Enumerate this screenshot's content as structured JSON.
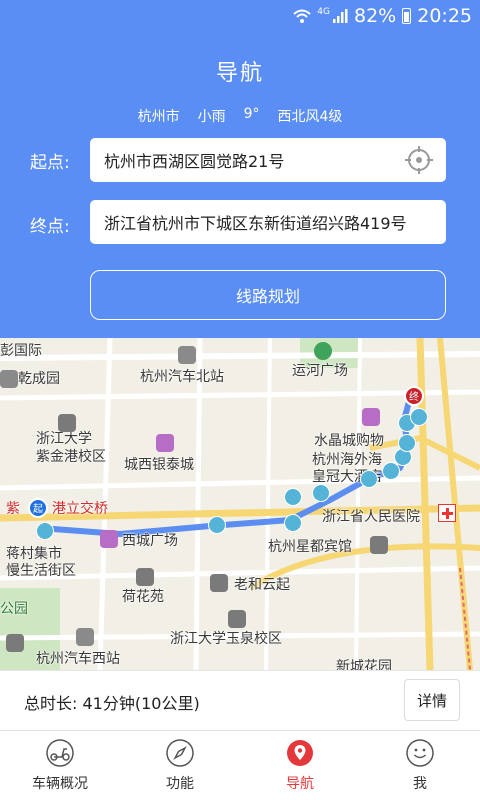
{
  "status_bar": {
    "network": "4G",
    "battery": "82%",
    "time": "20:25"
  },
  "header": {
    "title": "导航",
    "weather": {
      "city": "杭州市",
      "condition": "小雨",
      "temperature": "9°",
      "wind": "西北风4级"
    }
  },
  "form": {
    "start_label": "起点:",
    "start_value": "杭州市西湖区圆觉路21号",
    "end_label": "终点:",
    "end_value": "浙江省杭州市下城区东新街道绍兴路419号",
    "plan_button": "线路规划"
  },
  "map": {
    "labels": [
      "彭国际",
      "乾成园",
      "杭州汽车北站",
      "运河广场",
      "浙江大学\n紫金港校区",
      "水晶城购物",
      "城西银泰城",
      "杭州海外海\n皇冠大酒店",
      "紫",
      "港立交桥",
      "浙江省人民医院",
      "西城广场",
      "杭州星都宾馆",
      "蒋村集市\n慢生活街区",
      "荷花苑",
      "老和云起",
      "公园",
      "浙江大学玉泉校区",
      "杭州汽车西站",
      "新城花园"
    ],
    "start_marker": "起",
    "end_marker": "终",
    "route_color": "#5b8ef0",
    "bike_color": "#54b3d6"
  },
  "summary": {
    "text": "总时长: 41分钟(10公里)",
    "detail_button": "详情"
  },
  "tabbar": {
    "tabs": [
      {
        "label": "车辆概况",
        "icon": "scooter-icon",
        "active": false
      },
      {
        "label": "功能",
        "icon": "compass-icon",
        "active": false
      },
      {
        "label": "导航",
        "icon": "location-pin-icon",
        "active": true
      },
      {
        "label": "我",
        "icon": "smiley-icon",
        "active": false
      }
    ],
    "active_color": "#e4393c"
  }
}
